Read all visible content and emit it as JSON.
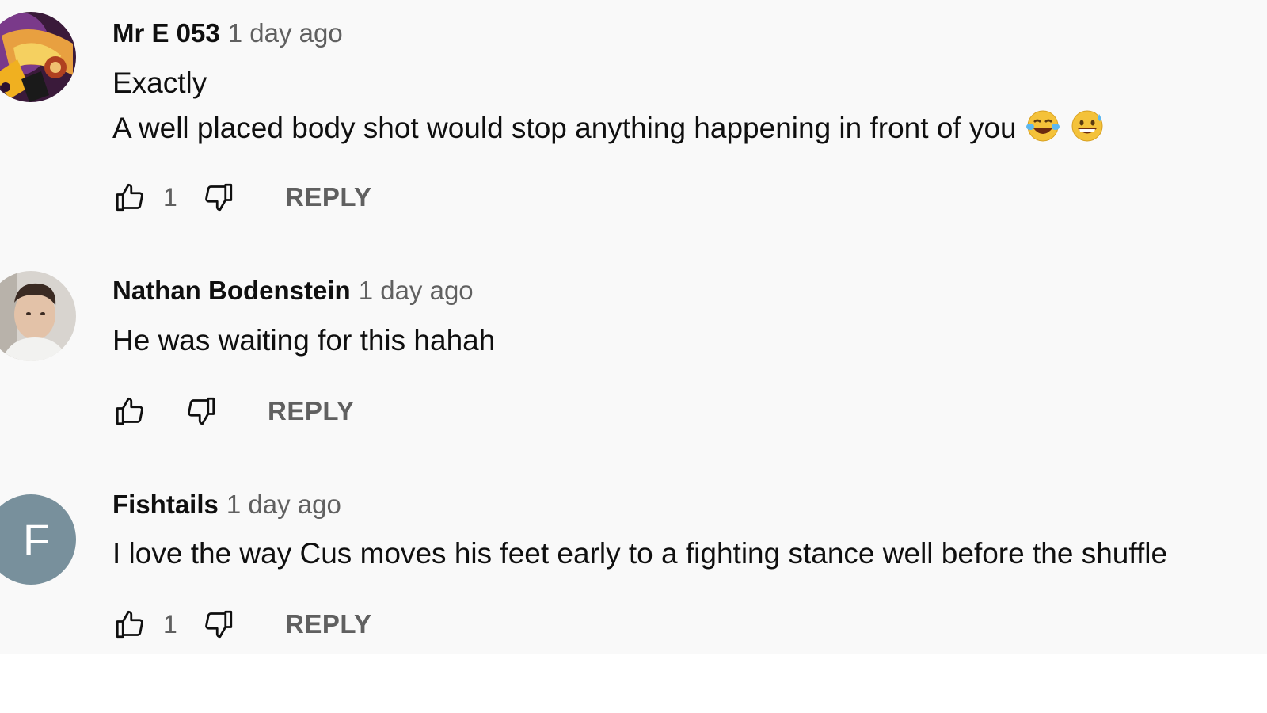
{
  "comments": [
    {
      "author": "Mr E 053",
      "time": "1 day ago",
      "text_lines": [
        "Exactly",
        "A well placed body shot would stop anything happening in front of you"
      ],
      "emojis": [
        "tears-of-joy-emoji",
        "grinning-sweat-emoji"
      ],
      "likes": "1",
      "reply_label": "REPLY",
      "avatar": "artwork-avatar"
    },
    {
      "author": "Nathan Bodenstein",
      "time": "1 day ago",
      "text_lines": [
        "He was waiting for this hahah"
      ],
      "likes": "",
      "reply_label": "REPLY",
      "avatar": "photo-avatar"
    },
    {
      "author": "Fishtails",
      "time": "1 day ago",
      "text_lines": [
        "I love the way Cus moves his feet early to a fighting stance well before the shuffle"
      ],
      "likes": "1",
      "reply_label": "REPLY",
      "avatar_letter": "F",
      "avatar_color": "#78909c"
    }
  ],
  "icons": {
    "like": "thumbs-up-icon",
    "dislike": "thumbs-down-icon"
  },
  "colors": {
    "background": "#f9f9f9",
    "text": "#0f0f0f",
    "secondary": "#606060"
  }
}
